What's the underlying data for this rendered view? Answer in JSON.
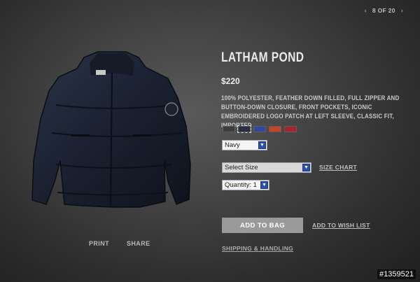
{
  "pager": {
    "prev_icon": "chevron-left-icon",
    "label": "8 OF 20",
    "next_icon": "chevron-right-icon"
  },
  "product": {
    "title": "LATHAM POND",
    "price": "$220",
    "description": "100% POLYESTER, FEATHER DOWN FILLED, FULL ZIPPER AND BUTTON-DOWN CLOSURE, FRONT POCKETS, ICONIC EMBROIDERED LOGO PATCH AT LEFT SLEEVE, CLASSIC FIT, IMPORTED"
  },
  "image_links": {
    "print": "PRINT",
    "share": "SHARE"
  },
  "swatches": [
    {
      "color": "#3a3c40",
      "selected": false
    },
    {
      "color": "#2a2e3e",
      "selected": true
    },
    {
      "color": "#2f4aa0",
      "selected": false
    },
    {
      "color": "#c74427",
      "selected": false
    },
    {
      "color": "#a8232a",
      "selected": false
    }
  ],
  "selects": {
    "color": "Navy",
    "size": "Select Size",
    "quantity": "Quantity: 1"
  },
  "links": {
    "size_chart": "SIZE CHART",
    "wish_list": "ADD TO WISH LIST",
    "shipping": "SHIPPING & HANDLING"
  },
  "buttons": {
    "add_to_bag": "ADD TO BAG"
  },
  "watermark": "#1359521"
}
